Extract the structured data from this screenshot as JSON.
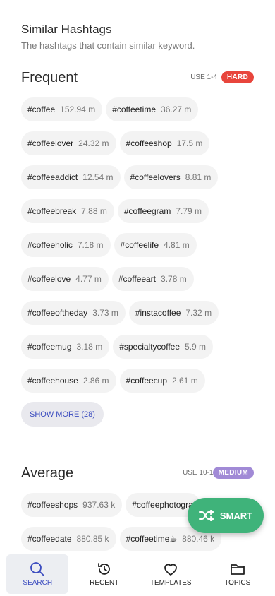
{
  "header": {
    "title": "Similar Hashtags",
    "subtitle": "The hashtags that contain similar keyword."
  },
  "frequent": {
    "title": "Frequent",
    "use": "USE 1-4",
    "badge": "HARD",
    "rows": [
      [
        {
          "tag": "#coffee",
          "count": "152.94 m"
        },
        {
          "tag": "#coffeetime",
          "count": "36.27 m"
        }
      ],
      [
        {
          "tag": "#coffeelover",
          "count": "24.32 m"
        },
        {
          "tag": "#coffeeshop",
          "count": "17.5 m"
        }
      ],
      [
        {
          "tag": "#coffeeaddict",
          "count": "12.54 m"
        },
        {
          "tag": "#coffeelovers",
          "count": "8.81 m"
        }
      ],
      [
        {
          "tag": "#coffeebreak",
          "count": "7.88 m"
        },
        {
          "tag": "#coffeegram",
          "count": "7.79 m"
        }
      ],
      [
        {
          "tag": "#coffeeholic",
          "count": "7.18 m"
        },
        {
          "tag": "#coffeelife",
          "count": "4.81 m"
        }
      ],
      [
        {
          "tag": "#coffeelove",
          "count": "4.77 m"
        },
        {
          "tag": "#coffeeart",
          "count": "3.78 m"
        }
      ],
      [
        {
          "tag": "#coffeeoftheday",
          "count": "3.73 m"
        },
        {
          "tag": "#instacoffee",
          "count": "7.32 m"
        }
      ],
      [
        {
          "tag": "#coffeemug",
          "count": "3.18 m"
        },
        {
          "tag": "#specialtycoffee",
          "count": "5.9 m"
        }
      ],
      [
        {
          "tag": "#coffeehouse",
          "count": "2.86 m"
        },
        {
          "tag": "#coffeecup",
          "count": "2.61 m"
        }
      ]
    ],
    "show_more": "SHOW MORE (28)"
  },
  "average": {
    "title": "Average",
    "use": "USE 10-15",
    "badge": "MEDIUM",
    "rows": [
      [
        {
          "tag": "#coffeeshops",
          "count": "937.63 k"
        },
        {
          "tag": "#coffeephotogra",
          "count": ""
        }
      ],
      [
        {
          "tag": "#coffeedate",
          "count": "880.85 k"
        },
        {
          "tag": "#coffeetime☕",
          "count": "880.46 k"
        }
      ]
    ]
  },
  "fab": {
    "label": "SMART",
    "icon": "shuffle-icon"
  },
  "nav": [
    {
      "label": "SEARCH",
      "icon": "search-icon",
      "active": true
    },
    {
      "label": "RECENT",
      "icon": "history-icon",
      "active": false
    },
    {
      "label": "TEMPLATES",
      "icon": "heart-icon",
      "active": false
    },
    {
      "label": "TOPICS",
      "icon": "folder-icon",
      "active": false
    }
  ],
  "colors": {
    "accent": "#3a4bbf",
    "hard": "#e8453c",
    "medium": "#a18ad6",
    "smart": "#3fb37a"
  }
}
